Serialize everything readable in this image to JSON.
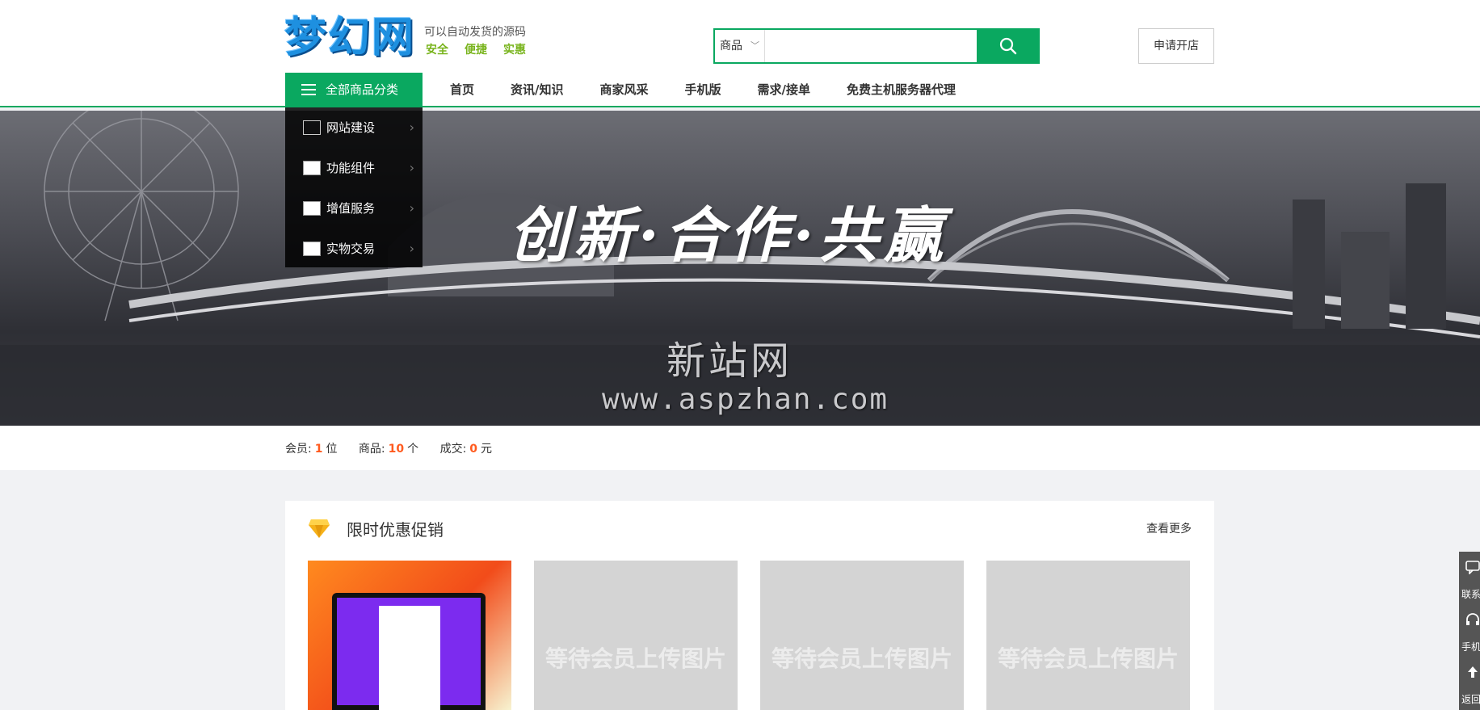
{
  "header": {
    "logo_text": "梦幻网",
    "tagline": "可以自动发货的源码",
    "tag_words": [
      "安全",
      "便捷",
      "实惠"
    ],
    "search": {
      "type_label": "商品",
      "placeholder": ""
    },
    "apply_label": "申请开店"
  },
  "nav": {
    "category_label": "全部商品分类",
    "links": [
      "首页",
      "资讯/知识",
      "商家风采",
      "手机版",
      "需求/接单",
      "免费主机服务器代理"
    ]
  },
  "categories": [
    "网站建设",
    "功能组件",
    "增值服务",
    "实物交易"
  ],
  "banner": {
    "slogan": "创新·合作·共赢",
    "site_name": "新站网",
    "url": "www.aspzhan.com"
  },
  "stats": {
    "members_label": "会员:",
    "members_value": "1",
    "members_unit": "位",
    "products_label": "商品:",
    "products_value": "10",
    "products_unit": "个",
    "deals_label": "成交:",
    "deals_value": "0",
    "deals_unit": "元"
  },
  "promo": {
    "title": "限时优惠促销",
    "more_label": "查看更多",
    "placeholder_text": "等待会员上传图片"
  },
  "side_toolbar": [
    "联系",
    "手机",
    "返回"
  ],
  "colors": {
    "accent": "#0aa860",
    "highlight": "#ff5a1e",
    "tag_green": "#79b41d"
  }
}
